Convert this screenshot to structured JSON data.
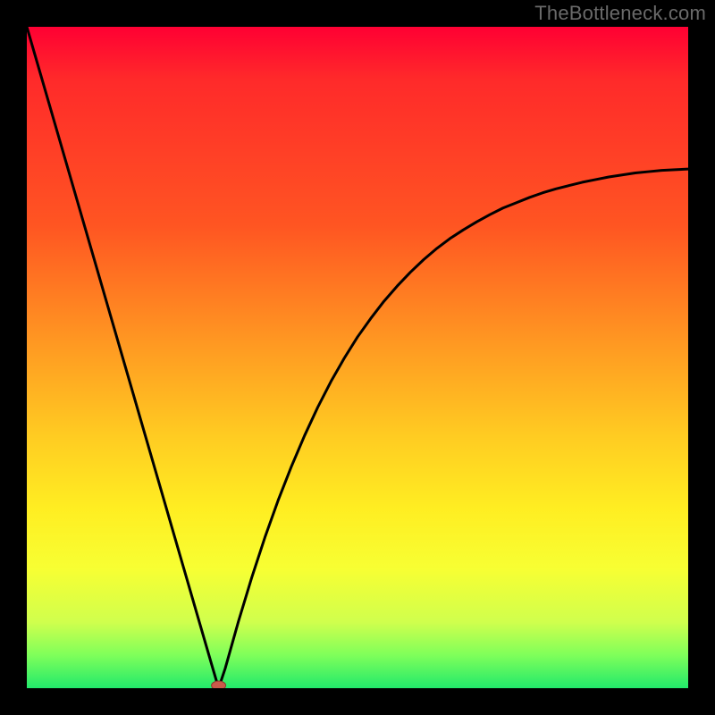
{
  "watermark": "TheBottleneck.com",
  "colors": {
    "frame": "#000000",
    "curve": "#000000",
    "marker_fill": "#c95a4a",
    "marker_stroke": "#8a3a2e",
    "grad_top": "#ff0033",
    "grad_bottom": "#22e96b"
  },
  "chart_data": {
    "type": "line",
    "title": "",
    "xlabel": "",
    "ylabel": "",
    "xlim": [
      0,
      100
    ],
    "ylim": [
      0,
      100
    ],
    "grid": false,
    "legend": false,
    "notes": "V-shaped bottleneck curve. Minimum near x≈29, y≈0. Left branch nearly linear from (0,100) to (29,0). Right branch rises concavely toward (100,~78).",
    "series": [
      {
        "name": "curve",
        "x": [
          0,
          2,
          4,
          6,
          8,
          10,
          12,
          14,
          16,
          18,
          20,
          22,
          24,
          26,
          28,
          29,
          30,
          32,
          34,
          36,
          38,
          40,
          42,
          44,
          46,
          48,
          50,
          52,
          54,
          56,
          58,
          60,
          62,
          64,
          66,
          68,
          70,
          72,
          74,
          76,
          78,
          80,
          82,
          84,
          86,
          88,
          90,
          92,
          94,
          96,
          98,
          100
        ],
        "y": [
          100,
          93.1,
          86.2,
          79.3,
          72.4,
          65.5,
          58.6,
          51.7,
          44.8,
          37.9,
          31.0,
          24.1,
          17.2,
          10.3,
          3.4,
          0.0,
          3.0,
          10.1,
          16.7,
          22.8,
          28.4,
          33.5,
          38.2,
          42.5,
          46.4,
          49.9,
          53.1,
          55.9,
          58.5,
          60.8,
          62.9,
          64.8,
          66.5,
          68.0,
          69.3,
          70.5,
          71.6,
          72.6,
          73.4,
          74.2,
          74.9,
          75.5,
          76.0,
          76.5,
          76.9,
          77.3,
          77.6,
          77.9,
          78.1,
          78.3,
          78.4,
          78.5
        ]
      }
    ],
    "marker": {
      "x": 29,
      "y": 0,
      "rx": 8,
      "ry": 5
    }
  }
}
